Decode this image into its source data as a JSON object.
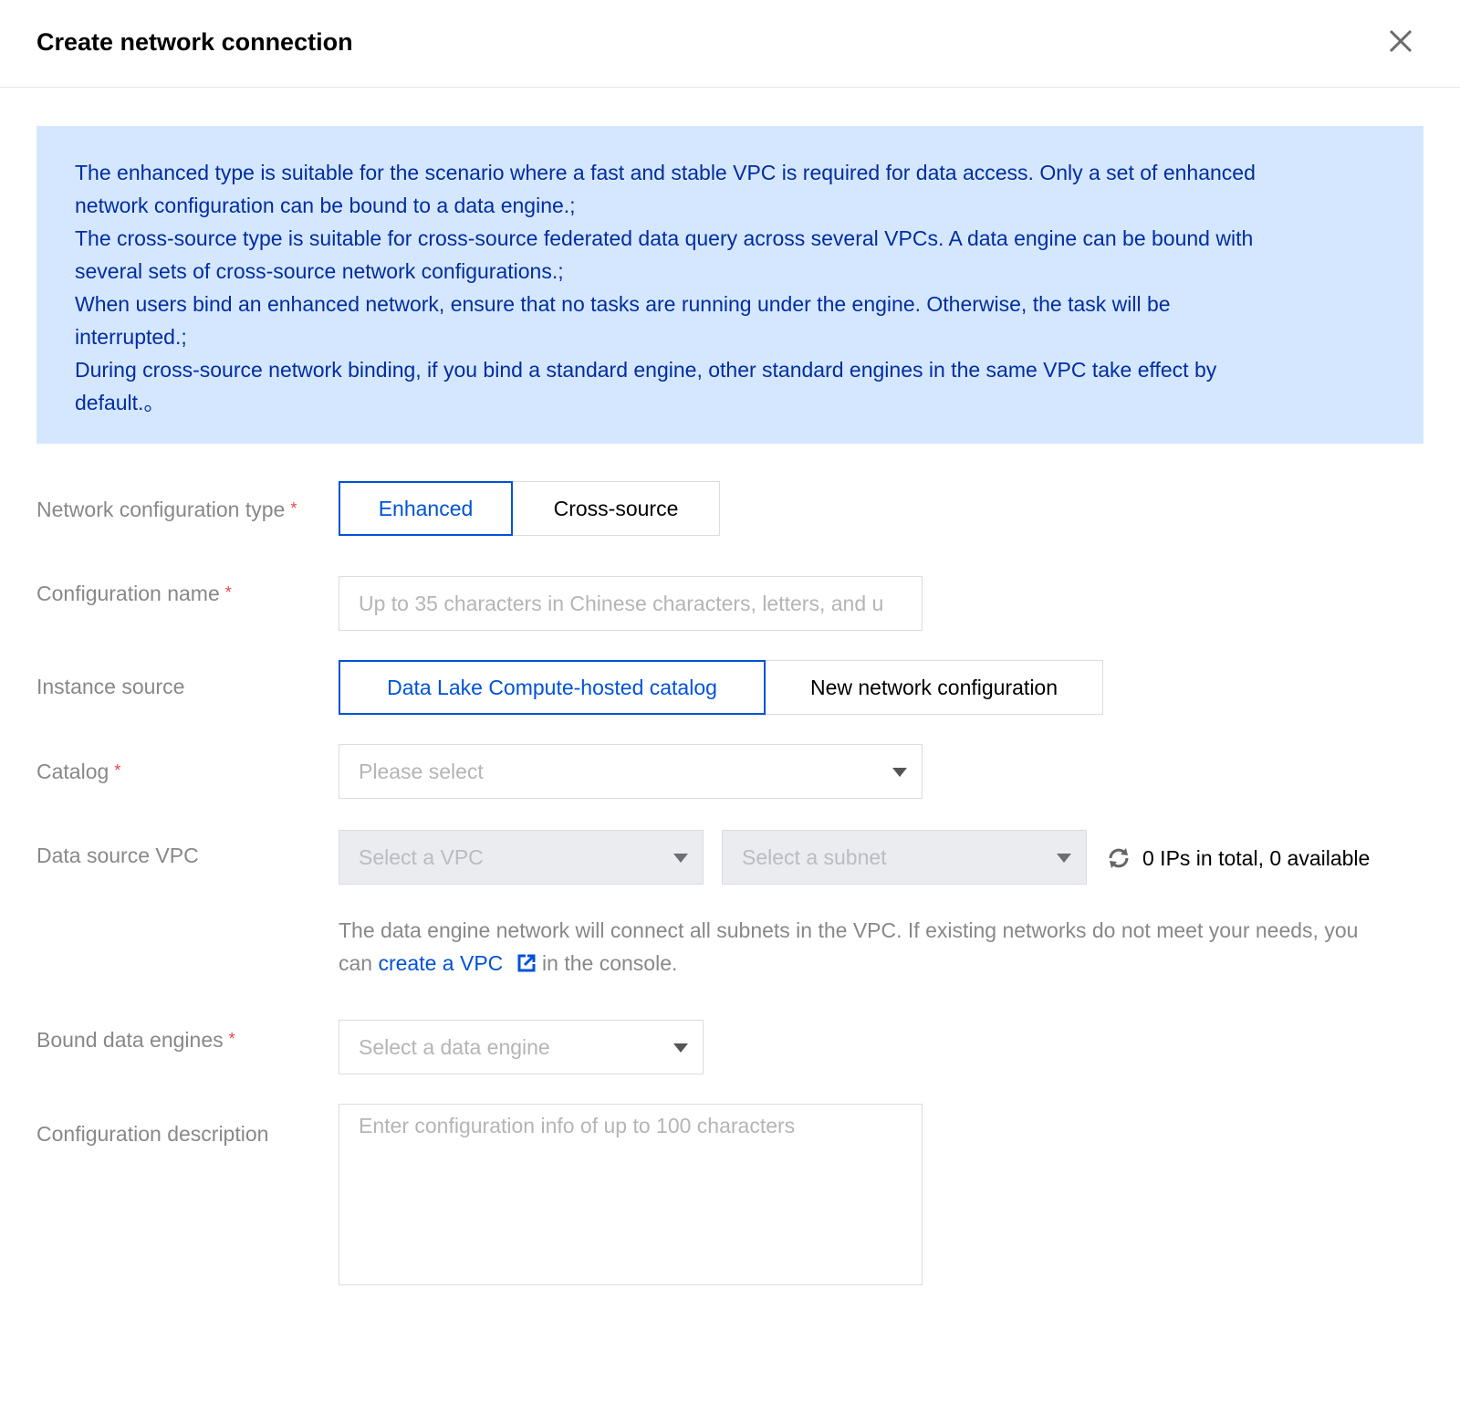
{
  "dialog": {
    "title": "Create network connection"
  },
  "notice": {
    "lines": [
      "The enhanced type is suitable for the scenario where a fast and stable VPC is required for data access. Only a set of enhanced",
      "network configuration can be bound to a data engine.;",
      "The cross-source type is suitable for cross-source federated data query across several VPCs. A data engine can be bound with",
      "several sets of cross-source network configurations.;",
      "When users bind an enhanced network, ensure that no tasks are running under the engine. Otherwise, the task will be",
      "interrupted.;",
      "During cross-source network binding, if you bind a standard engine, other standard engines in the same VPC take effect by",
      "default.。"
    ]
  },
  "form": {
    "network_type": {
      "label": "Network configuration type",
      "required_mark": "*",
      "options": [
        "Enhanced",
        "Cross-source"
      ],
      "selected": "Enhanced"
    },
    "config_name": {
      "label": "Configuration name",
      "required_mark": "*",
      "placeholder": "Up to 35 characters in Chinese characters, letters, and u"
    },
    "instance_source": {
      "label": "Instance source",
      "options": [
        "Data Lake Compute-hosted catalog",
        "New network configuration"
      ],
      "selected": "Data Lake Compute-hosted catalog"
    },
    "catalog": {
      "label": "Catalog",
      "required_mark": "*",
      "placeholder": "Please select"
    },
    "vpc": {
      "label": "Data source VPC",
      "vpc_placeholder": "Select a VPC",
      "subnet_placeholder": "Select a subnet",
      "ip_info": "0 IPs in total, 0 available",
      "help_prefix": "The data engine network will connect all subnets in the VPC. If existing networks do not meet your needs, you",
      "help_can": "can ",
      "help_link": "create a VPC",
      "help_suffix": " in the console."
    },
    "engines": {
      "label": "Bound data engines",
      "required_mark": "*",
      "placeholder": "Select a data engine"
    },
    "description": {
      "label": "Configuration description",
      "placeholder": "Enter configuration info of up to 100 characters"
    }
  },
  "colors": {
    "accent": "#0052d9",
    "notice_bg": "#d5e7ff",
    "notice_text": "#002da0",
    "required": "#e54545"
  }
}
